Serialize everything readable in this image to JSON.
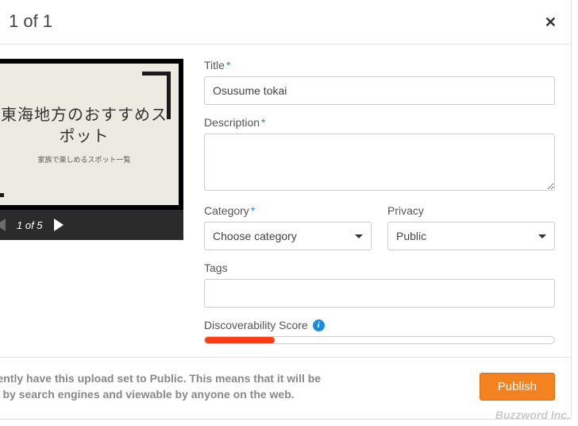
{
  "header": {
    "partial_title": "1 of 1"
  },
  "preview": {
    "slide_title_jp": "東海地方のおすすめスポット",
    "slide_sub_jp": "家族で楽しめるスポット一覧",
    "counter": "1 of 5"
  },
  "form": {
    "title_label": "Title",
    "title_value": "Osusume tokai",
    "description_label": "Description",
    "description_value": "",
    "category_label": "Category",
    "category_value": "Choose category",
    "privacy_label": "Privacy",
    "privacy_value": "Public",
    "tags_label": "Tags",
    "tags_value": "",
    "disc_label": "Discoverability Score",
    "disc_fill_percent": 20
  },
  "footer": {
    "notice_line1": "rently have this upload set to Public. This means that it will be",
    "notice_line2": "d by search engines and viewable by anyone on the web.",
    "publish_label": "Publish"
  },
  "watermark": "Buzzword Inc."
}
